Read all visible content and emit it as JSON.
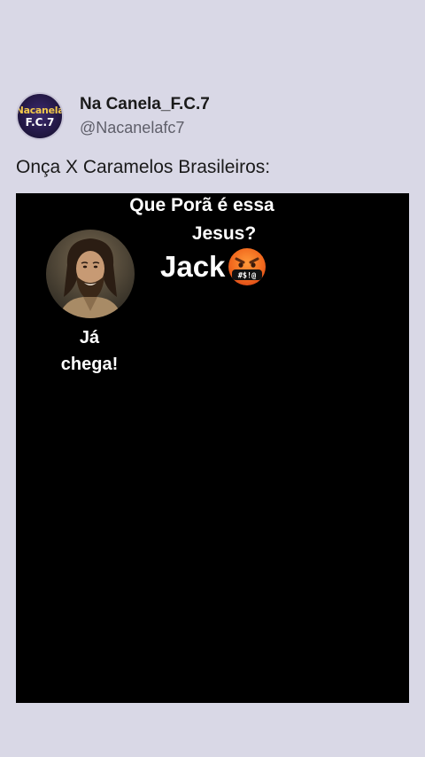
{
  "post": {
    "display_name": "Na Canela_F.C.7",
    "handle": "@Nacanelafc7",
    "avatar_text_line1": "Nacanela",
    "avatar_text_line2": "F.C.7",
    "text": "Onça X Caramelos Brasileiros:"
  },
  "media": {
    "caption_top": "Que Porã é essa",
    "caption_jesus": "Jesus?",
    "caption_jack": "Jack",
    "caption_reply_line1": "Já",
    "caption_reply_line2": "chega!",
    "emoji_icon": "cursing-face-emoji",
    "emoji_symbols": "#$!@"
  },
  "colors": {
    "background": "#d9d8e6",
    "media_background": "#000000",
    "text_primary": "#1a1a1a",
    "text_secondary": "#5f5f6a"
  }
}
